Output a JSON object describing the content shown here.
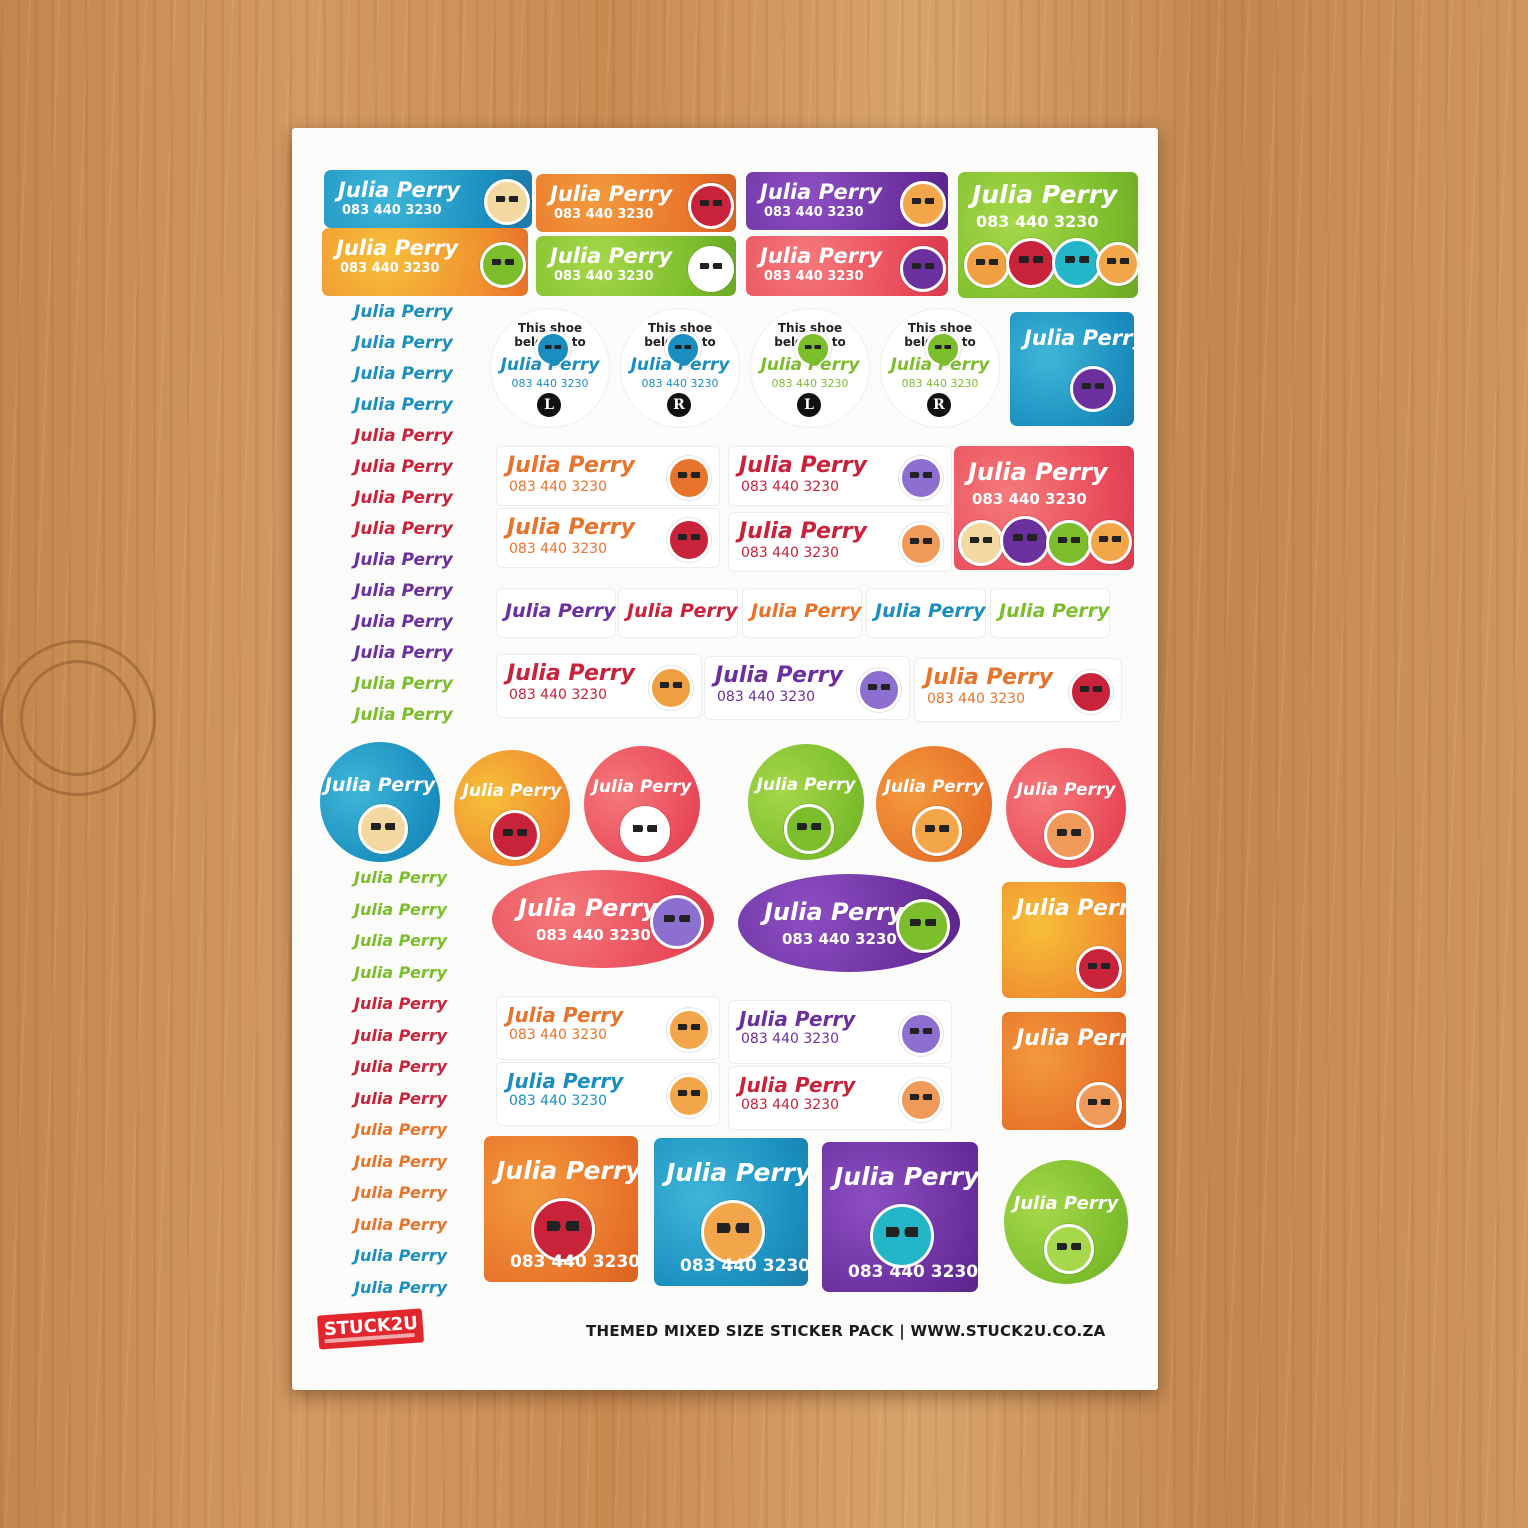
{
  "sticker": {
    "name": "Julia Perry",
    "phone": "083 440 3230",
    "shoe_text": "This shoe belongs to",
    "left": "L",
    "right": "R"
  },
  "brand": {
    "logo": "STUCK2U"
  },
  "footer": {
    "text": "THEMED MIXED SIZE STICKER PACK | WWW.STUCK2U.CO.ZA"
  },
  "colors": {
    "blue": "#1a8fbf",
    "orange": "#e8732a",
    "purple": "#6b2f9e",
    "green": "#7cbd2c",
    "pink": "#e94a5a",
    "red": "#c8233a"
  }
}
